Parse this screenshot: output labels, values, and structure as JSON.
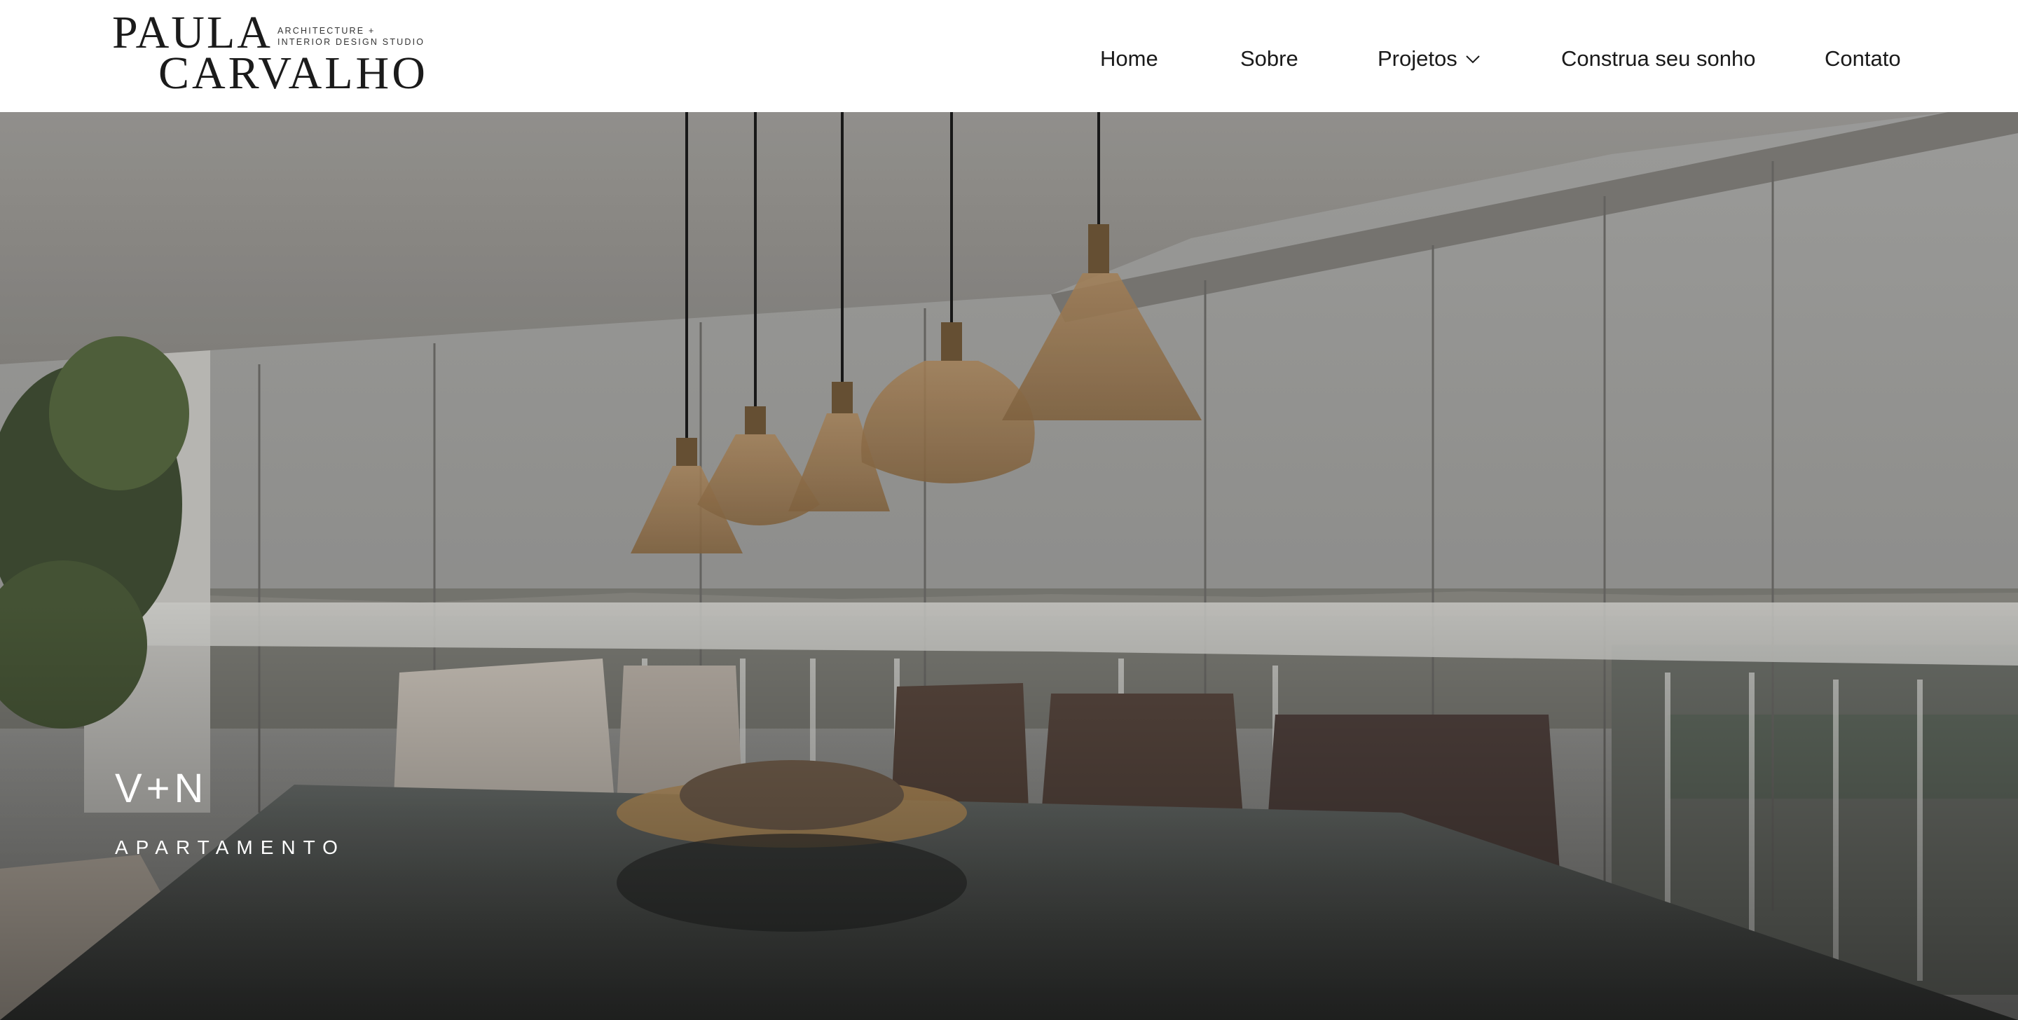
{
  "brand": {
    "line1": "PAULA",
    "line2": "CARVALHO",
    "tagline_1": "ARCHITECTURE +",
    "tagline_2": "INTERIOR DESIGN STUDIO"
  },
  "nav": {
    "home": "Home",
    "sobre": "Sobre",
    "projetos": "Projetos",
    "construa": "Construa seu sonho",
    "contato": "Contato"
  },
  "hero": {
    "title": "V+N",
    "subtitle": "APARTAMENTO"
  },
  "icons": {
    "dropdown": "chevron-down-icon"
  },
  "colors": {
    "header_bg": "#ffffff",
    "text": "#1a1a1a",
    "hero_text": "#ffffff"
  }
}
